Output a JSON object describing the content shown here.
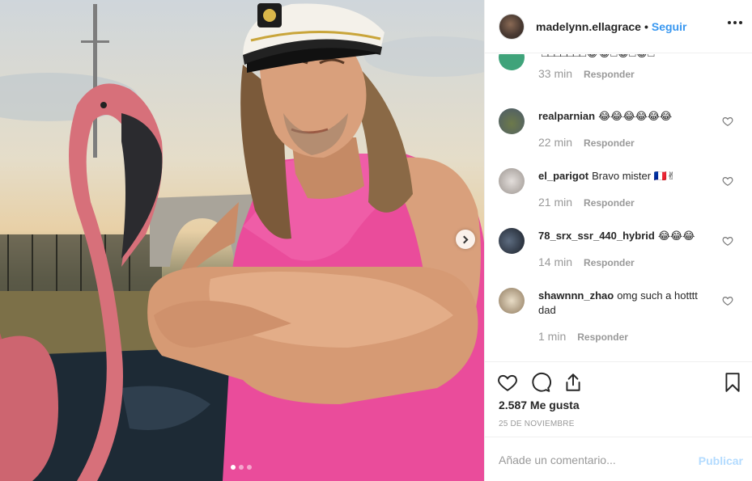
{
  "post": {
    "author": "madelynn.ellagrace",
    "separator": "•",
    "follow_label": "Seguir",
    "more_icon": "more-options-icon",
    "carousel": {
      "current": 1,
      "total": 3,
      "next_icon": "chevron-right-icon"
    }
  },
  "comments": [
    {
      "username": "",
      "text": "□□□□□□□😂😂□😂□😂□",
      "time": "33 min",
      "reply": "Responder",
      "avatar_color": "#3fa37a",
      "show_like": false
    },
    {
      "username": "realparnian",
      "text": "😂😂😂😂😂😂",
      "time": "22 min",
      "reply": "Responder",
      "avatar_color": "#6d7a4a",
      "show_like": true
    },
    {
      "username": "el_parigot",
      "text": "Bravo mister 🇫🇷✌",
      "time": "21 min",
      "reply": "Responder",
      "avatar_color": "#b9b2ad",
      "show_like": true
    },
    {
      "username": "78_srx_ssr_440_hybrid",
      "text": "😂😂😂",
      "time": "14 min",
      "reply": "Responder",
      "avatar_color": "#2a3140",
      "show_like": true
    },
    {
      "username": "shawnnn_zhao",
      "text": "omg such a hotttt dad",
      "time": "1 min",
      "reply": "Responder",
      "avatar_color": "#c8b89a",
      "show_like": true
    }
  ],
  "actions": {
    "like_icon": "heart-icon",
    "comment_icon": "comment-icon",
    "share_icon": "share-icon",
    "save_icon": "bookmark-icon",
    "likes": "2.587 Me gusta",
    "date": "25 DE NOVIEMBRE"
  },
  "add_comment": {
    "placeholder": "Añade un comentario...",
    "post_label": "Publicar"
  },
  "colors": {
    "link": "#3897f0",
    "muted": "#999999",
    "post_disabled": "#b3dbff"
  }
}
